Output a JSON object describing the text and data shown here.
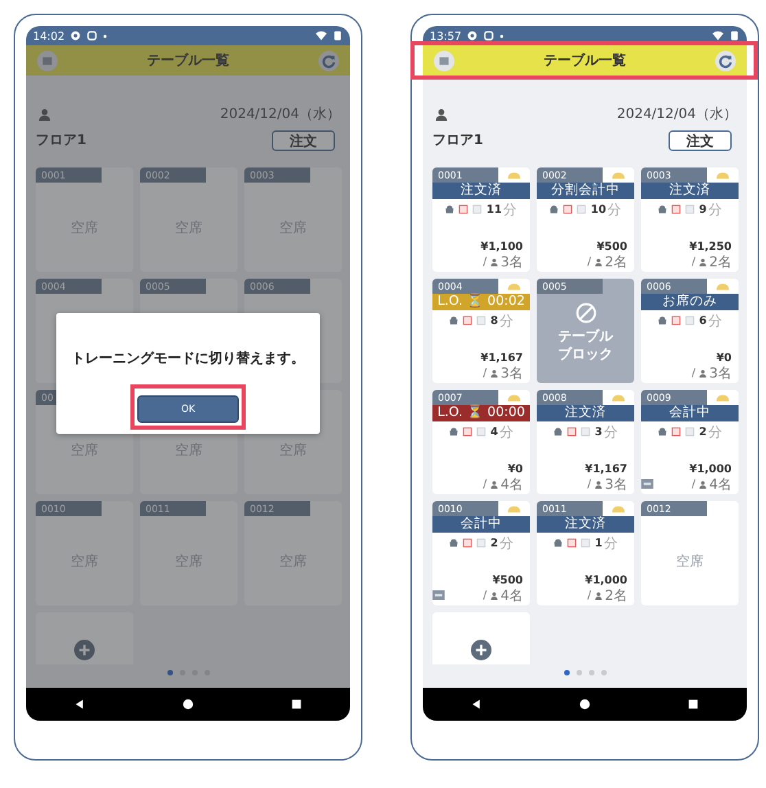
{
  "phones": [
    {
      "status_bar": {
        "time": "14:02"
      },
      "header": {
        "title": "テーブル一覧",
        "highlighted": false
      },
      "date": "2024/12/04（水）",
      "floor": "フロア1",
      "order_button": "注文",
      "dimmed": true,
      "tables": [
        {
          "kind": "vacant",
          "number": "0001",
          "label": "空席"
        },
        {
          "kind": "vacant",
          "number": "0002",
          "label": "空席"
        },
        {
          "kind": "vacant",
          "number": "0003",
          "label": "空席"
        },
        {
          "kind": "vacant",
          "number": "0004"
        },
        {
          "kind": "vacant",
          "number": "0005"
        },
        {
          "kind": "vacant",
          "number": "0006"
        },
        {
          "kind": "vacant",
          "number": "00",
          "label": "空席"
        },
        {
          "kind": "vacant",
          "label": "空席"
        },
        {
          "kind": "vacant",
          "label": "空席"
        },
        {
          "kind": "vacant",
          "number": "0010",
          "label": "空席"
        },
        {
          "kind": "vacant",
          "number": "0011",
          "label": "空席"
        },
        {
          "kind": "vacant",
          "number": "0012",
          "label": "空席"
        }
      ],
      "page_dots": [
        {
          "selected": true
        },
        {
          "selected": false
        },
        {
          "selected": false
        },
        {
          "selected": false
        }
      ],
      "dialog": {
        "message": "トレーニングモードに切り替えます。",
        "button": "OK",
        "button_highlighted": true
      }
    },
    {
      "status_bar": {
        "time": "13:57"
      },
      "header": {
        "title": "テーブル一覧",
        "highlighted": true
      },
      "date": "2024/12/04（水）",
      "floor": "フロア1",
      "order_button": "注文",
      "dimmed": false,
      "tables": [
        {
          "kind": "occupied",
          "number": "0001",
          "status": "注文済",
          "color": "#3d5f8a",
          "minutes": "11",
          "unit": "分",
          "amount": "¥1,100",
          "separator": "/",
          "guests": "3名",
          "tagged": false
        },
        {
          "kind": "occupied",
          "number": "0002",
          "status": "分割会計中",
          "color": "#3d5f8a",
          "minutes": "10",
          "unit": "分",
          "amount": "¥500",
          "separator": "/",
          "guests": "2名",
          "tagged": false
        },
        {
          "kind": "occupied",
          "number": "0003",
          "status": "注文済",
          "color": "#3d5f8a",
          "minutes": "9",
          "unit": "分",
          "amount": "¥1,250",
          "separator": "/",
          "guests": "2名",
          "tagged": false
        },
        {
          "kind": "occupied",
          "number": "0004",
          "status": "L.O. ⏳ 00:02",
          "color": "#d1a52a",
          "minutes": "8",
          "unit": "分",
          "amount": "¥1,167",
          "separator": "/",
          "guests": "3名",
          "tagged": false
        },
        {
          "kind": "blocked",
          "number": "0005",
          "lines": [
            "テーブル",
            "ブロック"
          ]
        },
        {
          "kind": "occupied",
          "number": "0006",
          "status": "お席のみ",
          "color": "#3d5f8a",
          "minutes": "6",
          "unit": "分",
          "amount": "¥0",
          "separator": "/",
          "guests": "3名",
          "tagged": false
        },
        {
          "kind": "occupied",
          "number": "0007",
          "status": "L.O. ⏳ 00:00",
          "color": "#9b2c2c",
          "minutes": "4",
          "unit": "分",
          "amount": "¥0",
          "separator": "/",
          "guests": "4名",
          "tagged": false
        },
        {
          "kind": "occupied",
          "number": "0008",
          "status": "注文済",
          "color": "#3d5f8a",
          "minutes": "3",
          "unit": "分",
          "amount": "¥1,167",
          "separator": "/",
          "guests": "3名",
          "tagged": false
        },
        {
          "kind": "occupied",
          "number": "0009",
          "status": "会計中",
          "color": "#3d5f8a",
          "minutes": "2",
          "unit": "分",
          "amount": "¥1,000",
          "separator": "/",
          "guests": "4名",
          "tagged": true
        },
        {
          "kind": "occupied",
          "number": "0010",
          "status": "会計中",
          "color": "#3d5f8a",
          "minutes": "2",
          "unit": "分",
          "amount": "¥500",
          "separator": "/",
          "guests": "4名",
          "tagged": true
        },
        {
          "kind": "occupied",
          "number": "0011",
          "status": "注文済",
          "color": "#3d5f8a",
          "minutes": "1",
          "unit": "分",
          "amount": "¥1,000",
          "separator": "/",
          "guests": "2名",
          "tagged": false
        },
        {
          "kind": "vacant",
          "number": "0012",
          "label": "空席"
        }
      ],
      "page_dots": [
        {
          "selected": true
        },
        {
          "selected": false
        },
        {
          "selected": false
        },
        {
          "selected": false
        }
      ]
    }
  ]
}
